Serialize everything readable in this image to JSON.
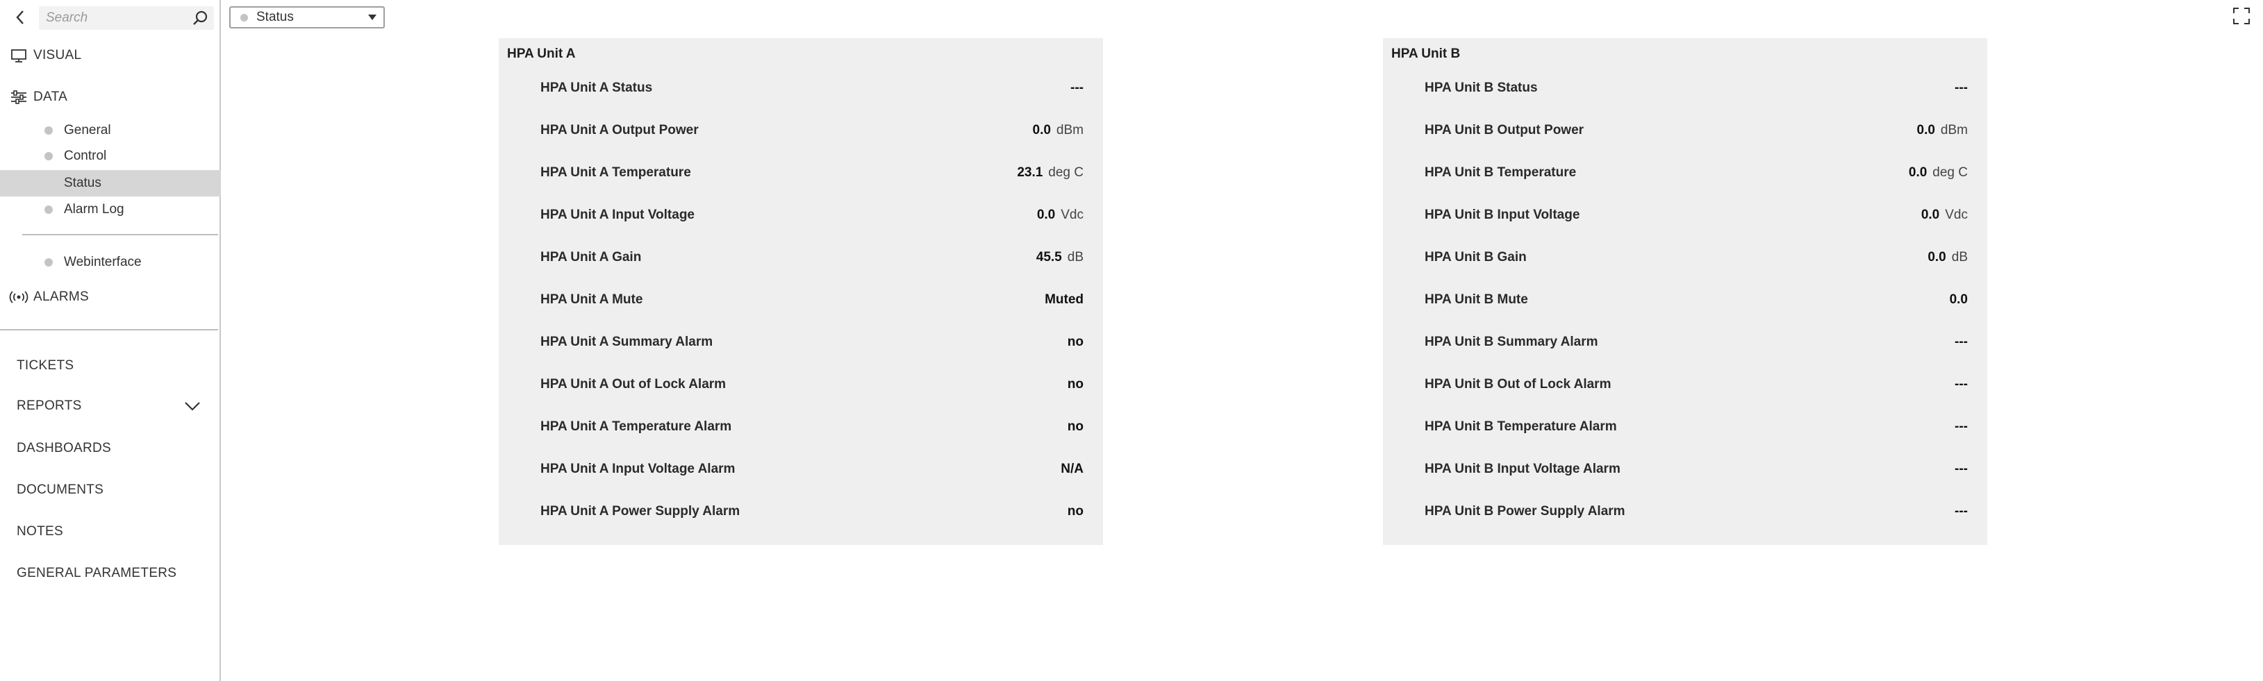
{
  "search": {
    "placeholder": "Search"
  },
  "sidebar": {
    "visual_label": "VISUAL",
    "data_label": "DATA",
    "data_items": [
      {
        "label": "General"
      },
      {
        "label": "Control"
      },
      {
        "label": "Status"
      },
      {
        "label": "Alarm Log"
      }
    ],
    "webinterface_label": "Webinterface",
    "alarms_label": "ALARMS",
    "bottom_items": [
      {
        "label": "TICKETS"
      },
      {
        "label": "REPORTS"
      },
      {
        "label": "DASHBOARDS"
      },
      {
        "label": "DOCUMENTS"
      },
      {
        "label": "NOTES"
      },
      {
        "label": "GENERAL PARAMETERS"
      }
    ]
  },
  "view_select": {
    "value": "Status"
  },
  "panels": [
    {
      "title": "HPA Unit A",
      "rows": [
        {
          "label": "HPA Unit A Status",
          "value": "---",
          "unit": ""
        },
        {
          "label": "HPA Unit A Output Power",
          "value": "0.0",
          "unit": "dBm"
        },
        {
          "label": "HPA Unit A Temperature",
          "value": "23.1",
          "unit": "deg C"
        },
        {
          "label": "HPA Unit A Input Voltage",
          "value": "0.0",
          "unit": "Vdc"
        },
        {
          "label": "HPA Unit A Gain",
          "value": "45.5",
          "unit": "dB"
        },
        {
          "label": "HPA Unit A Mute",
          "value": "Muted",
          "unit": ""
        },
        {
          "label": "HPA Unit A Summary Alarm",
          "value": "no",
          "unit": ""
        },
        {
          "label": "HPA Unit A Out of Lock Alarm",
          "value": "no",
          "unit": ""
        },
        {
          "label": "HPA Unit A Temperature Alarm",
          "value": "no",
          "unit": ""
        },
        {
          "label": "HPA Unit A Input Voltage Alarm",
          "value": "N/A",
          "unit": ""
        },
        {
          "label": "HPA Unit A Power Supply Alarm",
          "value": "no",
          "unit": ""
        }
      ]
    },
    {
      "title": "HPA Unit B",
      "rows": [
        {
          "label": "HPA Unit B Status",
          "value": "---",
          "unit": ""
        },
        {
          "label": "HPA Unit B Output Power",
          "value": "0.0",
          "unit": "dBm"
        },
        {
          "label": "HPA Unit B Temperature",
          "value": "0.0",
          "unit": "deg C"
        },
        {
          "label": "HPA Unit B Input Voltage",
          "value": "0.0",
          "unit": "Vdc"
        },
        {
          "label": "HPA Unit B Gain",
          "value": "0.0",
          "unit": "dB"
        },
        {
          "label": "HPA Unit B Mute",
          "value": "0.0",
          "unit": ""
        },
        {
          "label": "HPA Unit B Summary Alarm",
          "value": "---",
          "unit": ""
        },
        {
          "label": "HPA Unit B Out of Lock Alarm",
          "value": "---",
          "unit": ""
        },
        {
          "label": "HPA Unit B Temperature Alarm",
          "value": "---",
          "unit": ""
        },
        {
          "label": "HPA Unit B Input Voltage Alarm",
          "value": "---",
          "unit": ""
        },
        {
          "label": "HPA Unit B Power Supply Alarm",
          "value": "---",
          "unit": ""
        }
      ]
    }
  ]
}
